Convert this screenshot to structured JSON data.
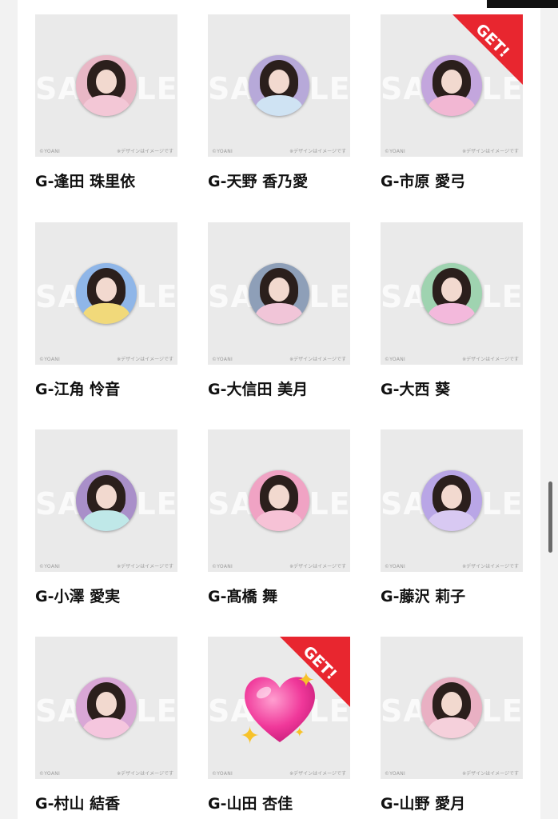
{
  "watermark": "SAMPLE",
  "copyright": "©YOANI",
  "design_note": "※デザインはイメージです",
  "get_label": "GET!",
  "items": [
    {
      "name": "G-逢田 珠里依",
      "got": false,
      "bg": "#e9b7c6",
      "body": "#f3c7d6",
      "icon": "member-photo"
    },
    {
      "name": "G-天野 香乃愛",
      "got": false,
      "bg": "#b7a9d9",
      "body": "#cfe3f3",
      "icon": "member-photo"
    },
    {
      "name": "G-市原 愛弓",
      "got": true,
      "bg": "#c3a6dd",
      "body": "#f2b7d3",
      "icon": "member-photo"
    },
    {
      "name": "G-江角 怜音",
      "got": false,
      "bg": "#8fb6e8",
      "body": "#f1d97a",
      "icon": "member-photo"
    },
    {
      "name": "G-大信田 美月",
      "got": false,
      "bg": "#8e9fb8",
      "body": "#f1c5d8",
      "icon": "member-photo"
    },
    {
      "name": "G-大西 葵",
      "got": false,
      "bg": "#9fd3b0",
      "body": "#f3b9dc",
      "icon": "member-photo"
    },
    {
      "name": "G-小澤 愛実",
      "got": false,
      "bg": "#a98fc9",
      "body": "#bfe8e8",
      "icon": "member-photo"
    },
    {
      "name": "G-髙橋 舞",
      "got": false,
      "bg": "#f0a3c4",
      "body": "#f6c2d6",
      "icon": "member-photo"
    },
    {
      "name": "G-藤沢 莉子",
      "got": false,
      "bg": "#b9a6e6",
      "body": "#d8c9f2",
      "icon": "member-photo"
    },
    {
      "name": "G-村山 結香",
      "got": false,
      "bg": "#d9a7d6",
      "body": "#f5c6de",
      "icon": "member-photo"
    },
    {
      "name": "G-山田 杏佳",
      "got": true,
      "bg": "#eaeaea",
      "body": "#eaeaea",
      "icon": "sparkling-heart-icon"
    },
    {
      "name": "G-山野 愛月",
      "got": false,
      "bg": "#e9b0c3",
      "body": "#f5d0db",
      "icon": "member-photo"
    }
  ],
  "colors": {
    "get_badge": "#e8262f",
    "tile_bg": "#eaeaea"
  }
}
